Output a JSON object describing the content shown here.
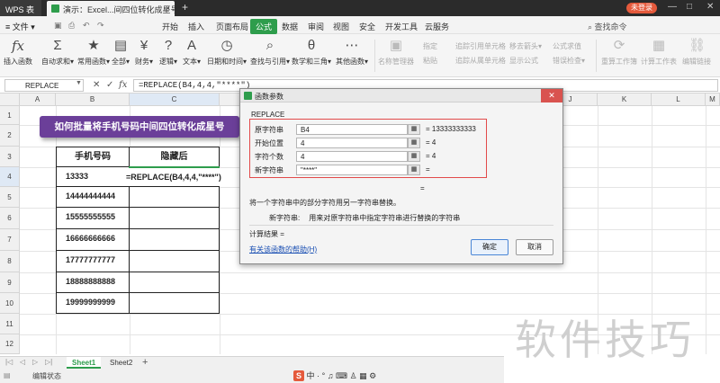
{
  "titlebar": {
    "app_name": "WPS 表格",
    "doc_tab": "演示：Excel...间四位转化成星号",
    "new_tab": "+",
    "login": "未登录",
    "minimize": "—",
    "maximize": "□",
    "close": "✕"
  },
  "menu": {
    "file": "≡ 文件 ▾",
    "items": [
      "开始",
      "插入",
      "页面布局",
      "公式",
      "数据",
      "审阅",
      "视图",
      "安全",
      "开发工具",
      "云服务"
    ],
    "active": "公式",
    "find_command": "查找命令"
  },
  "ribbon": {
    "buttons": [
      {
        "label": "插入函数",
        "icon": "fx"
      },
      {
        "label": "自动求和▾",
        "icon": "Σ"
      },
      {
        "label": "常用函数▾",
        "icon": "★"
      },
      {
        "label": "全部▾",
        "icon": "▤"
      },
      {
        "label": "财务▾",
        "icon": "¥"
      },
      {
        "label": "逻辑▾",
        "icon": "?"
      },
      {
        "label": "文本▾",
        "icon": "A"
      },
      {
        "label": "日期和时间▾",
        "icon": "◷"
      },
      {
        "label": "查找与引用▾",
        "icon": "⌕"
      },
      {
        "label": "数学和三角▾",
        "icon": "θ"
      },
      {
        "label": "其他函数▾",
        "icon": "⋯"
      },
      {
        "label": "名称管理器",
        "icon": "▣"
      },
      {
        "label": "重算工作簿",
        "icon": "⟳"
      },
      {
        "label": "计算工作表",
        "icon": "▦"
      },
      {
        "label": "编辑链接",
        "icon": "⛓"
      }
    ],
    "small_items": [
      "指定",
      "粘贴",
      "追踪引用单元格",
      "追踪从属单元格",
      "移去箭头▾",
      "显示公式",
      "公式求值",
      "错误检查▾"
    ]
  },
  "formula_bar": {
    "name_box": "REPLACE",
    "cancel": "✕",
    "confirm": "✓",
    "fx": "fx",
    "formula": "=REPLACE(B4,4,4,\"****\")"
  },
  "grid": {
    "columns": [
      "A",
      "B",
      "C",
      "D",
      "E",
      "F",
      "G",
      "H",
      "I",
      "J",
      "K",
      "L",
      "M"
    ],
    "rows": [
      "1",
      "2",
      "3",
      "4",
      "5",
      "6",
      "7",
      "8",
      "9",
      "10",
      "11",
      "12"
    ],
    "banner": "如何批量将手机号码中间四位转化成星号",
    "header_phone": "手机号码",
    "header_hidden": "隐藏后",
    "phones": [
      "13333",
      "14444444444",
      "15555555555",
      "16666666666",
      "17777777777",
      "18888888888",
      "19999999999"
    ],
    "editing_formula": "=REPLACE(B4,4,4,\"****\")"
  },
  "sheets": {
    "nav": [
      "|◁",
      "◁",
      "▷",
      "▷|"
    ],
    "tabs": [
      "Sheet1",
      "Sheet2"
    ],
    "add": "+",
    "active": "Sheet1"
  },
  "status": {
    "text": "编辑状态",
    "ime": [
      "S",
      "中",
      "·",
      "°",
      "♫",
      "⌨",
      "♙",
      "▦",
      "⚙"
    ]
  },
  "dialog": {
    "title": "函数参数",
    "close": "✕",
    "function_name": "REPLACE",
    "args": [
      {
        "label": "原字符串",
        "value": "B4",
        "result": "= 13333333333"
      },
      {
        "label": "开始位置",
        "value": "4",
        "result": "= 4"
      },
      {
        "label": "字符个数",
        "value": "4",
        "result": "= 4"
      },
      {
        "label": "新字符串",
        "value": "\"****\"",
        "result": "="
      }
    ],
    "function_result": "=",
    "description": "将一个字符串中的部分字符用另一字符串替换。",
    "arg_desc_label": "新字符串:",
    "arg_desc_text": "用来对原字符串中指定字符串进行替换的字符串",
    "calc_result": "计算结果 =",
    "help_link": "有关该函数的帮助(H)",
    "ok": "确定",
    "cancel": "取消"
  },
  "watermark": "软件技巧",
  "colors": {
    "accent": "#2e9d4c",
    "banner": "#6b3f99",
    "highlight_frame": "#e24a4a",
    "login": "#e55a3c"
  }
}
